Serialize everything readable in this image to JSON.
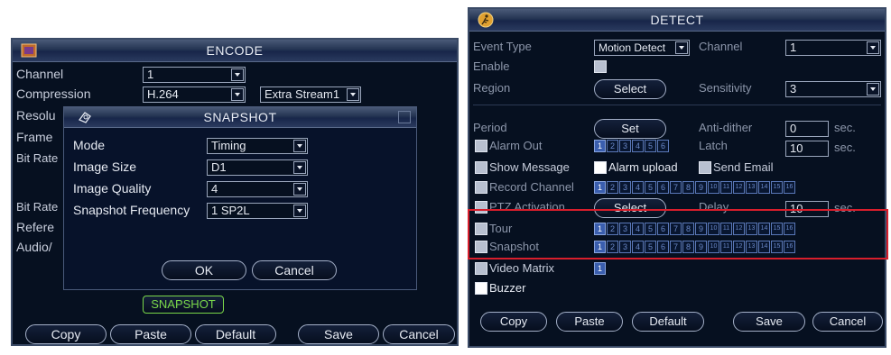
{
  "encode": {
    "title": "ENCODE",
    "channel_label": "Channel",
    "channel_value": "1",
    "compression_label": "Compression",
    "compression_value": "H.264",
    "extra_stream_value": "Extra Stream1",
    "resolution_label": "Resolu",
    "frame_label": "Frame",
    "bitrate_label": "Bit Rate",
    "bitrate2_label": "Bit Rate",
    "reference_label": "Refere",
    "audio_label": "Audio/",
    "snapshot_button": "SNAPSHOT",
    "buttons": {
      "copy": "Copy",
      "paste": "Paste",
      "default": "Default",
      "save": "Save",
      "cancel": "Cancel"
    }
  },
  "snapshot_dialog": {
    "title": "SNAPSHOT",
    "mode_label": "Mode",
    "mode_value": "Timing",
    "image_size_label": "Image Size",
    "image_size_value": "D1",
    "image_quality_label": "Image Quality",
    "image_quality_value": "4",
    "frequency_label": "Snapshot Frequency",
    "frequency_value": "1 SP2L",
    "ok": "OK",
    "cancel": "Cancel"
  },
  "detect": {
    "title": "DETECT",
    "event_type_label": "Event Type",
    "event_type_value": "Motion Detect",
    "channel_label": "Channel",
    "channel_value": "1",
    "enable_label": "Enable",
    "region_label": "Region",
    "region_button": "Select",
    "sensitivity_label": "Sensitivity",
    "sensitivity_value": "3",
    "period_label": "Period",
    "period_button": "Set",
    "antidither_label": "Anti-dither",
    "antidither_value": "0",
    "sec1": "sec.",
    "alarm_out_label": "Alarm Out",
    "latch_label": "Latch",
    "latch_value": "10",
    "sec2": "sec.",
    "show_message_label": "Show Message",
    "alarm_upload_label": "Alarm upload",
    "send_email_label": "Send Email",
    "record_channel_label": "Record Channel",
    "ptz_label": "PTZ Activation",
    "ptz_button": "Select",
    "delay_label": "Delay",
    "delay_value": "10",
    "sec3": "sec.",
    "tour_label": "Tour",
    "snapshot_label": "Snapshot",
    "video_matrix_label": "Video Matrix",
    "buzzer_label": "Buzzer",
    "channels6": [
      "1",
      "2",
      "3",
      "4",
      "5",
      "6"
    ],
    "channels16": [
      "1",
      "2",
      "3",
      "4",
      "5",
      "6",
      "7",
      "8",
      "9",
      "10",
      "11",
      "12",
      "13",
      "14",
      "15",
      "16"
    ],
    "matrix_channel": "1",
    "buttons": {
      "copy": "Copy",
      "paste": "Paste",
      "default": "Default",
      "save": "Save",
      "cancel": "Cancel"
    }
  }
}
